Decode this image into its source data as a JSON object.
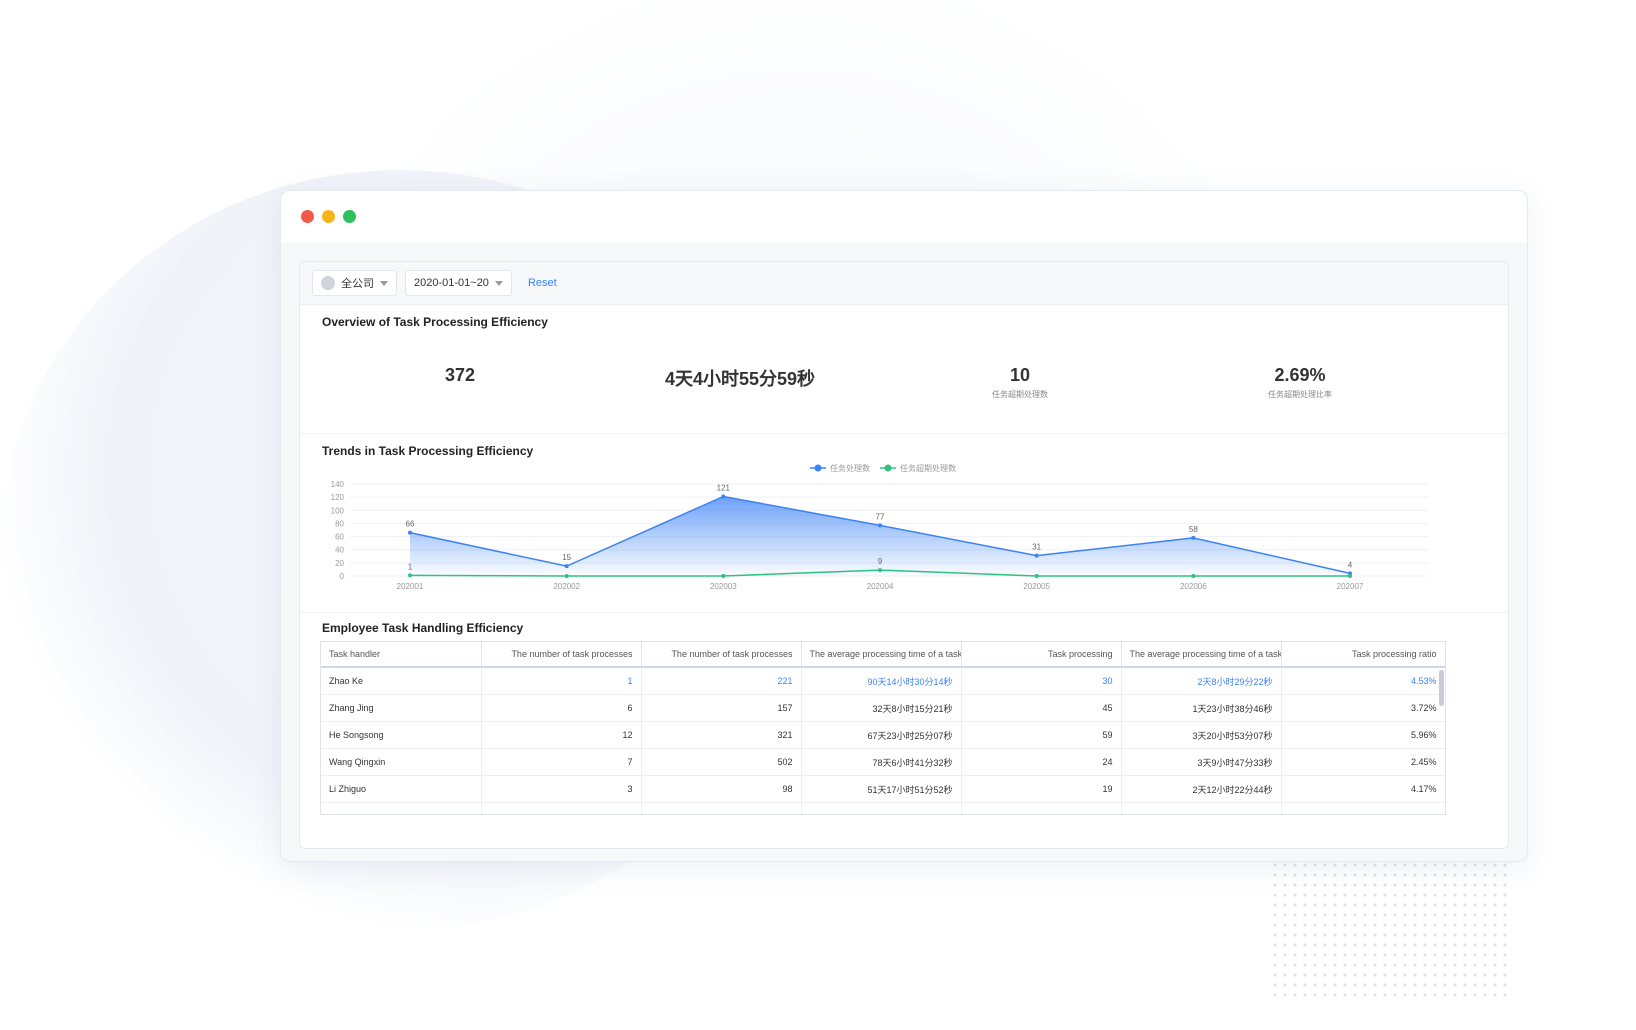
{
  "filters": {
    "company": "全公司",
    "date_range": "2020-01-01~20",
    "reset_label": "Reset"
  },
  "overview": {
    "title": "Overview of Task Processing Efficiency",
    "kpis": [
      {
        "value": "372",
        "label": ""
      },
      {
        "value": "4天4小时55分59秒",
        "label": ""
      },
      {
        "value": "10",
        "label": "任务超期处理数"
      },
      {
        "value": "2.69%",
        "label": "任务超期处理比率"
      }
    ]
  },
  "trend": {
    "title": "Trends in Task Processing Efficiency"
  },
  "chart_data": {
    "type": "line",
    "x": [
      "202001",
      "202002",
      "202003",
      "202004",
      "202005",
      "202006",
      "202007"
    ],
    "series": [
      {
        "name": "任务处理数",
        "values": [
          66,
          15,
          121,
          77,
          31,
          58,
          4
        ],
        "color": "#3b82f6",
        "area": true
      },
      {
        "name": "任务超期处理数",
        "values": [
          1,
          0,
          0,
          9,
          0,
          0,
          0
        ],
        "color": "#2ec27e",
        "area": false,
        "labels": [
          1,
          null,
          null,
          9,
          null,
          null,
          null
        ]
      }
    ],
    "ylim": [
      0,
      140
    ],
    "yticks": [
      0,
      20,
      40,
      60,
      80,
      100,
      120,
      140
    ],
    "grid": true,
    "legend": "top-center"
  },
  "employees": {
    "title": "Employee Task Handling Efficiency",
    "columns": [
      "Task handler",
      "The number of task processes",
      "The number of task processes",
      "The average processing time of a task",
      "Task processing",
      "The average processing time of a task",
      "Task processing ratio"
    ],
    "rows": [
      [
        "Zhao Ke",
        "1",
        "221",
        "90天14小时30分14秒",
        "30",
        "2天8小时29分22秒",
        "4.53%"
      ],
      [
        "Zhang Jing",
        "6",
        "157",
        "32天8小时15分21秒",
        "45",
        "1天23小时38分46秒",
        "3.72%"
      ],
      [
        "He Songsong",
        "12",
        "321",
        "67天23小时25分07秒",
        "59",
        "3天20小时53分07秒",
        "5.96%"
      ],
      [
        "Wang Qingxin",
        "7",
        "502",
        "78天6小时41分32秒",
        "24",
        "3天9小时47分33秒",
        "2.45%"
      ],
      [
        "Li Zhiguo",
        "3",
        "98",
        "51天17小时51分52秒",
        "19",
        "2天12小时22分44秒",
        "4.17%"
      ]
    ]
  },
  "colors": {
    "accent": "#3b82f6",
    "secondary": "#2ec27e",
    "traffic_red": "#f05a4a",
    "traffic_yellow": "#f6b419",
    "traffic_green": "#2ec05c"
  }
}
